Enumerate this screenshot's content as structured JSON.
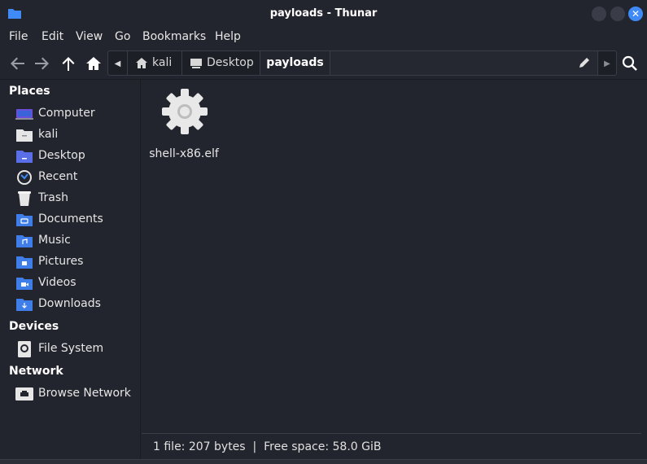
{
  "window": {
    "title": "payloads - Thunar"
  },
  "menubar": {
    "items": [
      {
        "label": "File"
      },
      {
        "label": "Edit"
      },
      {
        "label": "View"
      },
      {
        "label": "Go"
      },
      {
        "label": "Bookmarks"
      },
      {
        "label": "Help"
      }
    ]
  },
  "toolbar": {
    "icons": [
      "back-arrow-icon",
      "forward-arrow-icon",
      "up-arrow-icon",
      "home-icon"
    ]
  },
  "pathbar": {
    "segments": [
      {
        "label": "kali",
        "icon": "home-icon"
      },
      {
        "label": "Desktop",
        "icon": "desktop-icon"
      },
      {
        "label": "payloads",
        "active": true
      }
    ]
  },
  "sidebar": {
    "places_heading": "Places",
    "places": [
      {
        "label": "Computer",
        "icon": "computer-icon"
      },
      {
        "label": "kali",
        "icon": "home-folder-icon"
      },
      {
        "label": "Desktop",
        "icon": "desktop-folder-icon"
      },
      {
        "label": "Recent",
        "icon": "recent-icon"
      },
      {
        "label": "Trash",
        "icon": "trash-icon"
      },
      {
        "label": "Documents",
        "icon": "documents-folder-icon"
      },
      {
        "label": "Music",
        "icon": "music-folder-icon"
      },
      {
        "label": "Pictures",
        "icon": "pictures-folder-icon"
      },
      {
        "label": "Videos",
        "icon": "videos-folder-icon"
      },
      {
        "label": "Downloads",
        "icon": "downloads-folder-icon"
      }
    ],
    "devices_heading": "Devices",
    "devices": [
      {
        "label": "File System",
        "icon": "drive-icon"
      }
    ],
    "network_heading": "Network",
    "network": [
      {
        "label": "Browse Network",
        "icon": "network-icon"
      }
    ]
  },
  "main": {
    "files": [
      {
        "name": "shell-x86.elf",
        "icon": "executable-gear-icon"
      }
    ]
  },
  "statusbar": {
    "text": "1 file: 207 bytes  |  Free space: 58.0 GiB"
  },
  "colors": {
    "accent": "#3f8af7",
    "background": "#23252e",
    "folder_blue": "#3f7ee8"
  }
}
